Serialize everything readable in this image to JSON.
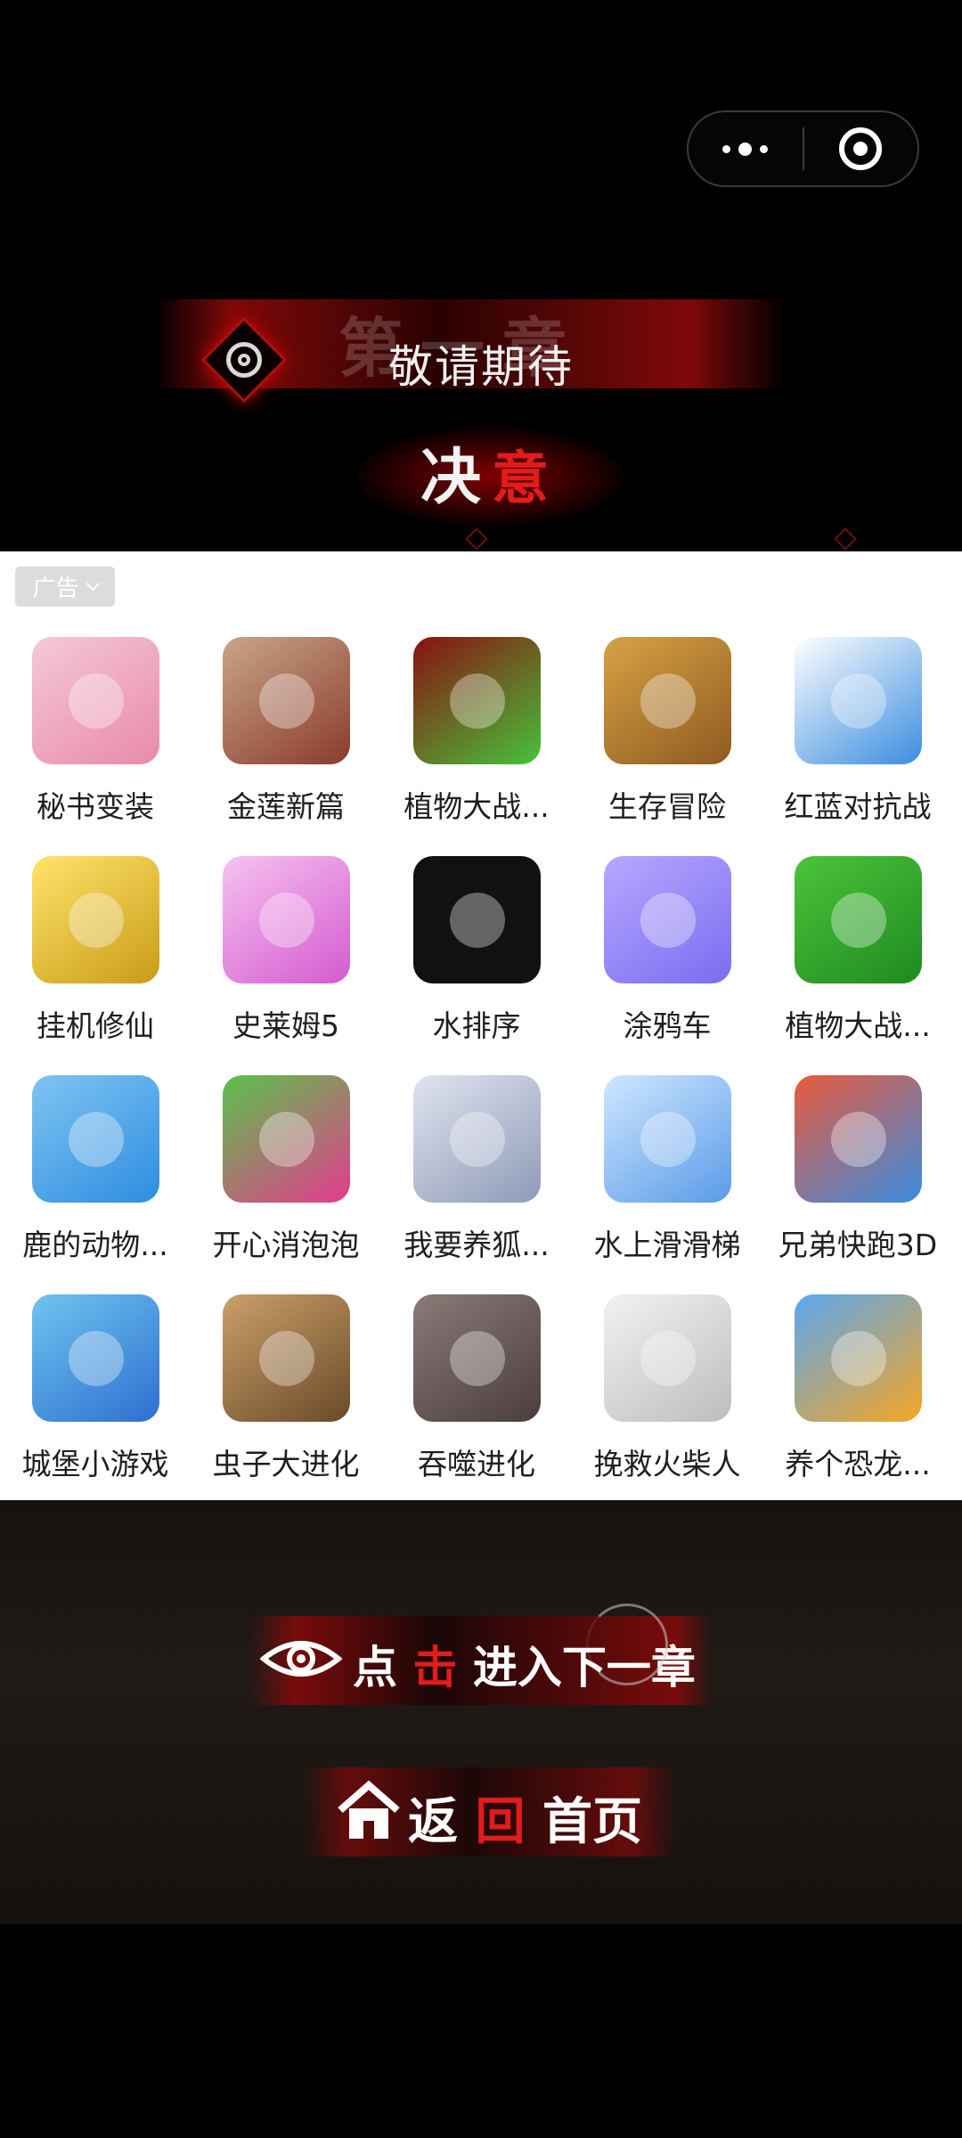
{
  "capsule": {
    "more_icon": "more-dots-icon",
    "close_icon": "target-circle-icon"
  },
  "banner": {
    "ghost_title": "第一章",
    "coming_soon": "敬请期待",
    "resolve_part1": "决",
    "resolve_part2": "意"
  },
  "ad": {
    "tag_label": "广告",
    "apps": [
      {
        "label": "秘书变装",
        "icon": "secretary-icon",
        "colors": [
          "#f4c9d6",
          "#e98aa8"
        ]
      },
      {
        "label": "金莲新篇",
        "icon": "lady-icon",
        "colors": [
          "#c9a58a",
          "#8a3b2b"
        ]
      },
      {
        "label": "植物大战...",
        "icon": "peashooter-icon",
        "colors": [
          "#8a1010",
          "#46c23a"
        ]
      },
      {
        "label": "生存冒险",
        "icon": "adventure-icon",
        "colors": [
          "#d6a245",
          "#8f5a20"
        ]
      },
      {
        "label": "红蓝对抗战",
        "icon": "crowd-icon",
        "colors": [
          "#ffffff",
          "#3b8de0"
        ]
      },
      {
        "label": "挂机修仙",
        "icon": "cultivation-icon",
        "colors": [
          "#ffe46b",
          "#c99b18"
        ]
      },
      {
        "label": "史莱姆5",
        "icon": "slime-icon",
        "colors": [
          "#f6c2f0",
          "#d45ad0"
        ]
      },
      {
        "label": "水排序",
        "icon": "tubes-icon",
        "colors": [
          "#111111",
          "#111111"
        ]
      },
      {
        "label": "涂鸦车",
        "icon": "doodle-car-icon",
        "colors": [
          "#b7a8ff",
          "#7a6cf0"
        ]
      },
      {
        "label": "植物大战...",
        "icon": "pepper-icon",
        "colors": [
          "#4bc43b",
          "#1f8a1f"
        ]
      },
      {
        "label": "鹿的动物...",
        "icon": "deer-icon",
        "colors": [
          "#7fc4f2",
          "#2e8de0"
        ]
      },
      {
        "label": "开心消泡泡",
        "icon": "bubbles-icon",
        "colors": [
          "#5ac24a",
          "#e33b8f"
        ]
      },
      {
        "label": "我要养狐...",
        "icon": "fox-girl-icon",
        "colors": [
          "#dfe4ee",
          "#8e9ab8"
        ]
      },
      {
        "label": "水上滑滑梯",
        "icon": "waterslide-icon",
        "colors": [
          "#cfe7ff",
          "#5a9be8"
        ]
      },
      {
        "label": "兄弟快跑3D",
        "icon": "runners-icon",
        "colors": [
          "#e95a3b",
          "#3a8de0"
        ]
      },
      {
        "label": "城堡小游戏",
        "icon": "castle-icon",
        "colors": [
          "#6fc4f0",
          "#2e6fd0"
        ]
      },
      {
        "label": "虫子大进化",
        "icon": "spider-icon",
        "colors": [
          "#caa06a",
          "#6a4a28"
        ]
      },
      {
        "label": "吞噬进化",
        "icon": "arena-icon",
        "colors": [
          "#8a7a78",
          "#4a3e3c"
        ]
      },
      {
        "label": "挽救火柴人",
        "icon": "stickman-icon",
        "colors": [
          "#f2f2f2",
          "#bdbdbd"
        ]
      },
      {
        "label": "养个恐龙...",
        "icon": "dino-icon",
        "colors": [
          "#5aa7f0",
          "#f5a623"
        ]
      }
    ]
  },
  "actions": {
    "next": {
      "part1": "点",
      "part2": "击",
      "part3": "进入下一章"
    },
    "home": {
      "part1": "返",
      "part2": "回",
      "part3": "首页"
    }
  }
}
